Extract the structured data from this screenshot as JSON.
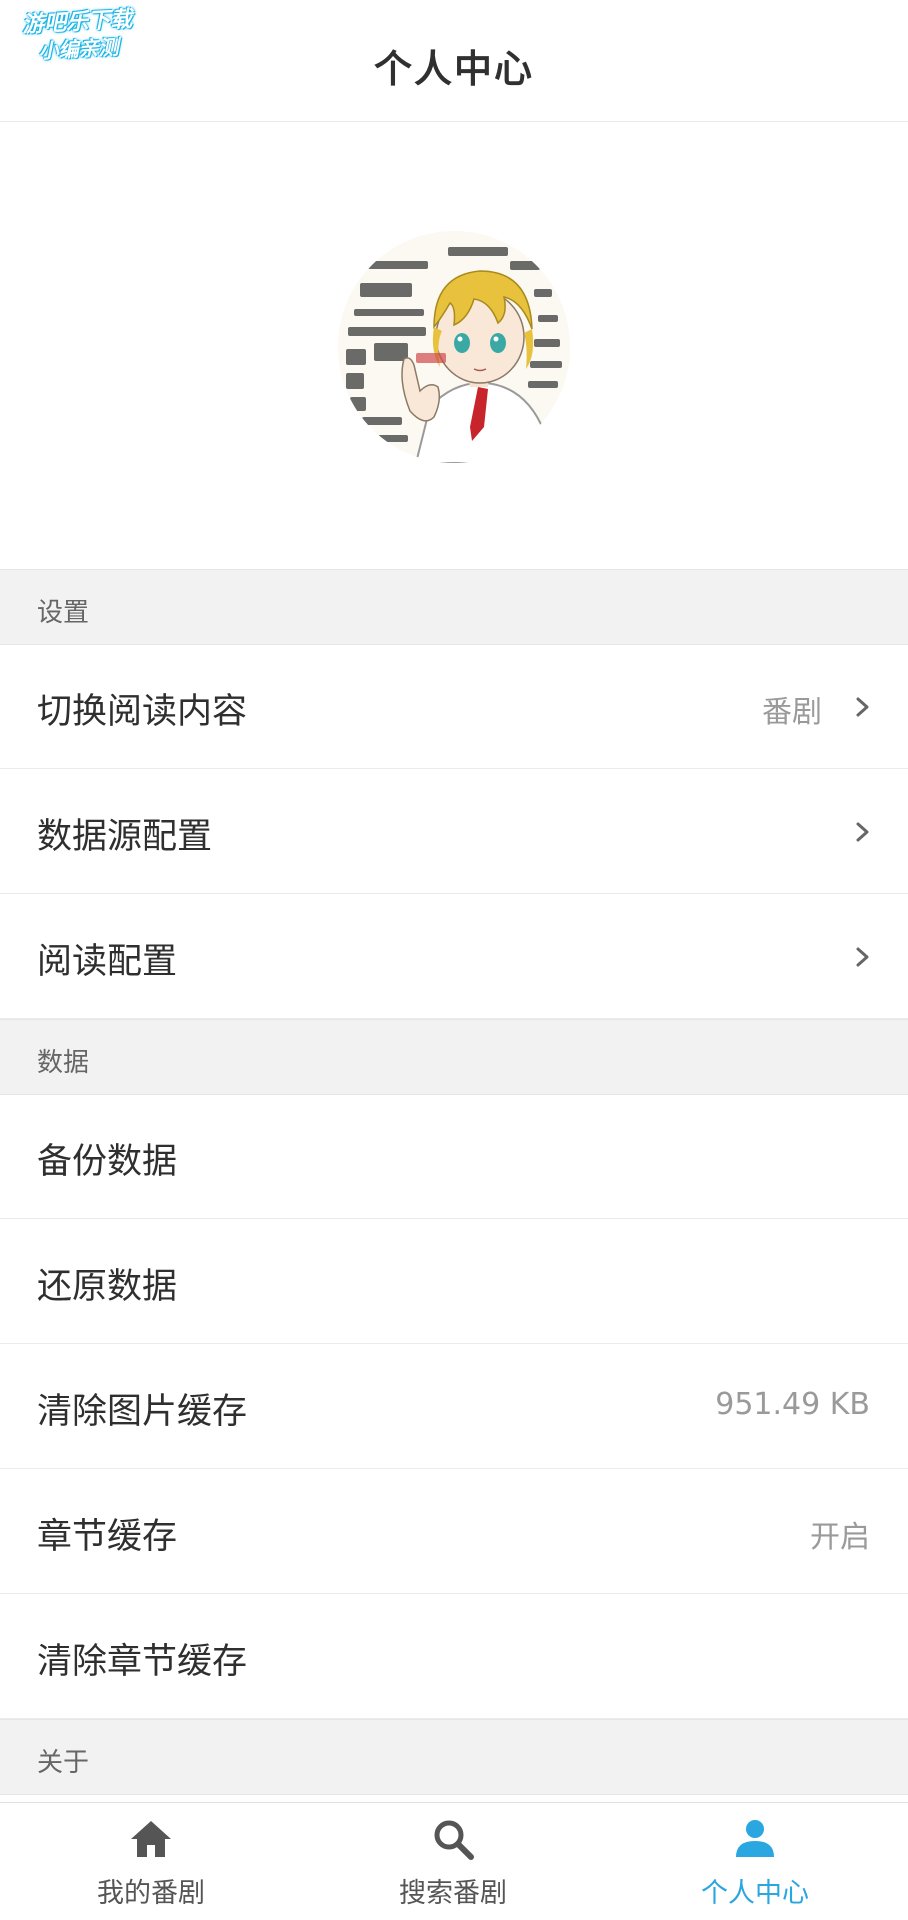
{
  "watermark": {
    "line1": "游吧乐下载",
    "line2": "小编亲测"
  },
  "header": {
    "title": "个人中心"
  },
  "settings": {
    "section_label": "设置",
    "items": [
      {
        "label": "切换阅读内容",
        "value": "番剧"
      },
      {
        "label": "数据源配置"
      },
      {
        "label": "阅读配置"
      }
    ]
  },
  "data_section": {
    "section_label": "数据",
    "items": [
      {
        "label": "备份数据"
      },
      {
        "label": "还原数据"
      },
      {
        "label": "清除图片缓存",
        "value": "951.49 KB"
      },
      {
        "label": "章节缓存",
        "value": "开启"
      },
      {
        "label": "清除章节缓存"
      }
    ]
  },
  "about_section": {
    "section_label": "关于"
  },
  "tabbar": {
    "tabs": [
      {
        "label": "我的番剧",
        "icon": "home-icon",
        "active": false
      },
      {
        "label": "搜索番剧",
        "icon": "search-icon",
        "active": false
      },
      {
        "label": "个人中心",
        "icon": "person-icon",
        "active": true
      }
    ]
  },
  "colors": {
    "accent": "#2aa6e0",
    "inactive": "#555555",
    "section_bg": "#f2f2f3"
  }
}
